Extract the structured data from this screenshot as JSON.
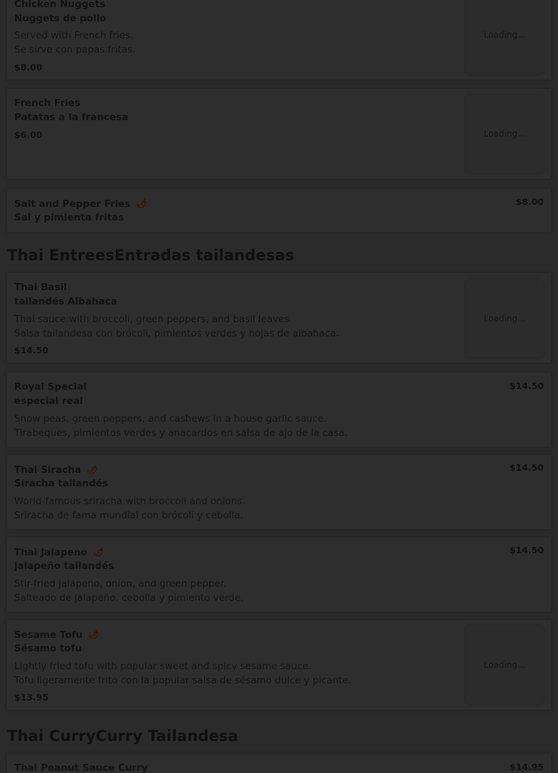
{
  "sections": [
    {
      "title_en": "Thai Entrees",
      "title_es": "Entradas tailandesas"
    },
    {
      "title_en": "Thai Curry",
      "title_es": "Curry Tailandesa"
    }
  ],
  "items": {
    "chicken_nuggets": {
      "name_en": "Chicken Nuggets",
      "name_es": "Nuggets de pollo",
      "desc_en": "Served with French fries.",
      "desc_es": "Se sirve con papas fritas.",
      "price": "$8.00",
      "image_status": "Loading..."
    },
    "french_fries": {
      "name_en": "French Fries",
      "name_es": "Patatas a la francesa",
      "price": "$6.00",
      "image_status": "Loading..."
    },
    "salt_pepper_fries": {
      "name_en": "Salt and Pepper Fries",
      "name_es": "Sal y pimienta fritas",
      "price": "$8.00",
      "spicy_icon": "chili-pepper-icon"
    },
    "thai_basil": {
      "name_en": "Thai Basil",
      "name_es": "tailandés Albahaca",
      "desc_en": "Thai sauce with broccoli, green peppers, and basil leaves.",
      "desc_es": "Salsa tailandesa con brócoli, pimientos verdes y hojas de albahaca.",
      "price": "$14.50",
      "image_status": "Loading..."
    },
    "royal_special": {
      "name_en": "Royal Special",
      "name_es": "especial real",
      "desc_en": "Snow peas, green peppers, and cashews in a house garlic sauce.",
      "desc_es": "Tirabeques, pimientos verdes y anacardos en salsa de ajo de la casa.",
      "price": "$14.50"
    },
    "thai_siracha": {
      "name_en": "Thai Siracha",
      "name_es": "Siracha tailandés",
      "desc_en": "World-famous sriracha with broccoli and onions.",
      "desc_es": "Sriracha de fama mundial con brócoli y cebolla.",
      "price": "$14.50",
      "spicy_icon": "chili-pepper-icon"
    },
    "thai_jalapeno": {
      "name_en": "Thai Jalapeno",
      "name_es": "jalapeño tailandés",
      "desc_en": "Stir-fried jalapeno, onion, and green pepper.",
      "desc_es": "Salteado de jalapeño, cebolla y pimiento verde.",
      "price": "$14.50",
      "spicy_icon": "chili-pepper-icon"
    },
    "sesame_tofu": {
      "name_en": "Sesame Tofu",
      "name_es": "Sésamo tofu",
      "desc_en": "Lightly fried tofu with popular sweet and spicy sesame sauce.",
      "desc_es": "Tofu ligeramente frito con la popular salsa de sésamo dulce y picante.",
      "price": "$13.95",
      "image_status": "Loading...",
      "spicy_icon": "chili-pepper-icon"
    },
    "thai_peanut_curry": {
      "name_en": "Thai Peanut Sauce Curry",
      "price": "$14.95"
    }
  },
  "colors": {
    "background": "#2b2b2b",
    "card": "#2e2e2e",
    "text": "#121212",
    "chili": "#3a1000"
  }
}
